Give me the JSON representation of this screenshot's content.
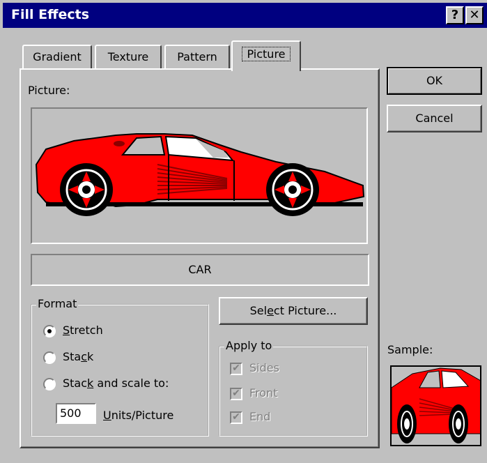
{
  "window": {
    "title": "Fill Effects",
    "help_label": "?",
    "close_label": "✕"
  },
  "tabs": [
    {
      "label": "Gradient"
    },
    {
      "label": "Texture"
    },
    {
      "label": "Pattern"
    },
    {
      "label": "Picture",
      "active": true
    }
  ],
  "picture": {
    "label": "Picture:",
    "name": "CAR"
  },
  "format": {
    "legend": "Format",
    "options": [
      {
        "label_pre": "",
        "accel": "S",
        "label_post": "tretch",
        "selected": true
      },
      {
        "label_pre": "Sta",
        "accel": "c",
        "label_post": "k",
        "selected": false
      },
      {
        "label_pre": "Stac",
        "accel": "k",
        "label_post": " and scale to:",
        "selected": false
      }
    ],
    "units_value": "500",
    "units_accel": "U",
    "units_label_post": "nits/Picture"
  },
  "select_picture": {
    "pre": "Sel",
    "accel": "e",
    "post": "ct Picture..."
  },
  "apply_to": {
    "legend": "Apply to",
    "items": [
      {
        "label": "Sides",
        "checked": true
      },
      {
        "label": "Front",
        "checked": true
      },
      {
        "label": "End",
        "checked": true
      }
    ]
  },
  "buttons": {
    "ok": "OK",
    "cancel": "Cancel"
  },
  "sample": {
    "label": "Sample:"
  },
  "colors": {
    "title_bg": "#000080",
    "car_red": "#ff0000"
  }
}
